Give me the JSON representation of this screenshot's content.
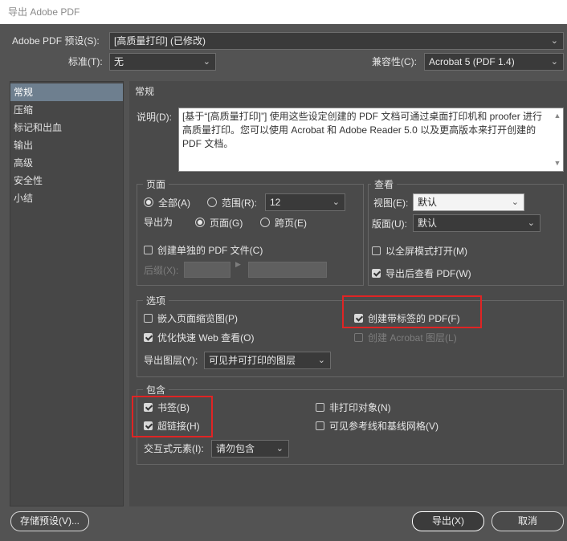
{
  "window": {
    "title": "导出 Adobe PDF"
  },
  "preset": {
    "label": "Adobe PDF 预设(S):",
    "value": "[高质量打印]  (已修改)"
  },
  "standard": {
    "label": "标准(T):",
    "value": "无"
  },
  "compat": {
    "label": "兼容性(C):",
    "value": "Acrobat 5 (PDF 1.4)"
  },
  "sidebar": {
    "items": [
      {
        "label": "常规"
      },
      {
        "label": "压缩"
      },
      {
        "label": "标记和出血"
      },
      {
        "label": "输出"
      },
      {
        "label": "高级"
      },
      {
        "label": "安全性"
      },
      {
        "label": "小结"
      }
    ]
  },
  "general": {
    "heading": "常规",
    "desc_label": "说明(D):",
    "desc_text": "[基于“[高质量打印]”] 使用这些设定创建的 PDF 文档可通过桌面打印机和 proofer 进行高质量打印。您可以使用 Acrobat 和 Adobe Reader 5.0 以及更高版本来打开创建的 PDF 文档。"
  },
  "pages": {
    "title": "页面",
    "all_label": "全部(A)",
    "range_label": "范围(R):",
    "range_value": "12",
    "export_as_label": "导出为",
    "pages_label": "页面(G)",
    "spreads_label": "跨页(E)",
    "single_pdf_label": "创建单独的 PDF 文件(C)",
    "suffix_label": "后缀(X):"
  },
  "view": {
    "title": "查看",
    "view_label": "视图(E):",
    "view_value": "默认",
    "layout_label": "版面(U):",
    "layout_value": "默认",
    "fullscreen_label": "以全屏模式打开(M)",
    "view_after_label": "导出后查看 PDF(W)"
  },
  "options": {
    "title": "选项",
    "embed_thumbs": "嵌入页面缩览图(P)",
    "optimize_web": "优化快速 Web 查看(O)",
    "tagged_pdf": "创建带标签的 PDF(F)",
    "acrobat_layers": "创建 Acrobat 图层(L)",
    "export_layers_label": "导出图层(Y):",
    "export_layers_value": "可见并可打印的图层"
  },
  "include": {
    "title": "包含",
    "bookmarks": "书签(B)",
    "hyperlinks": "超链接(H)",
    "nonprinting": "非打印对象(N)",
    "guides_grids": "可见参考线和基线网格(V)",
    "interactive_label": "交互式元素(I):",
    "interactive_value": "请勿包含"
  },
  "buttons": {
    "save_preset": "存储预设(V)...",
    "export": "导出(X)",
    "cancel": "取消"
  },
  "colors": {
    "panel": "#4a4a4a",
    "selection": "#6e7f8f",
    "highlight": "#e02424"
  }
}
